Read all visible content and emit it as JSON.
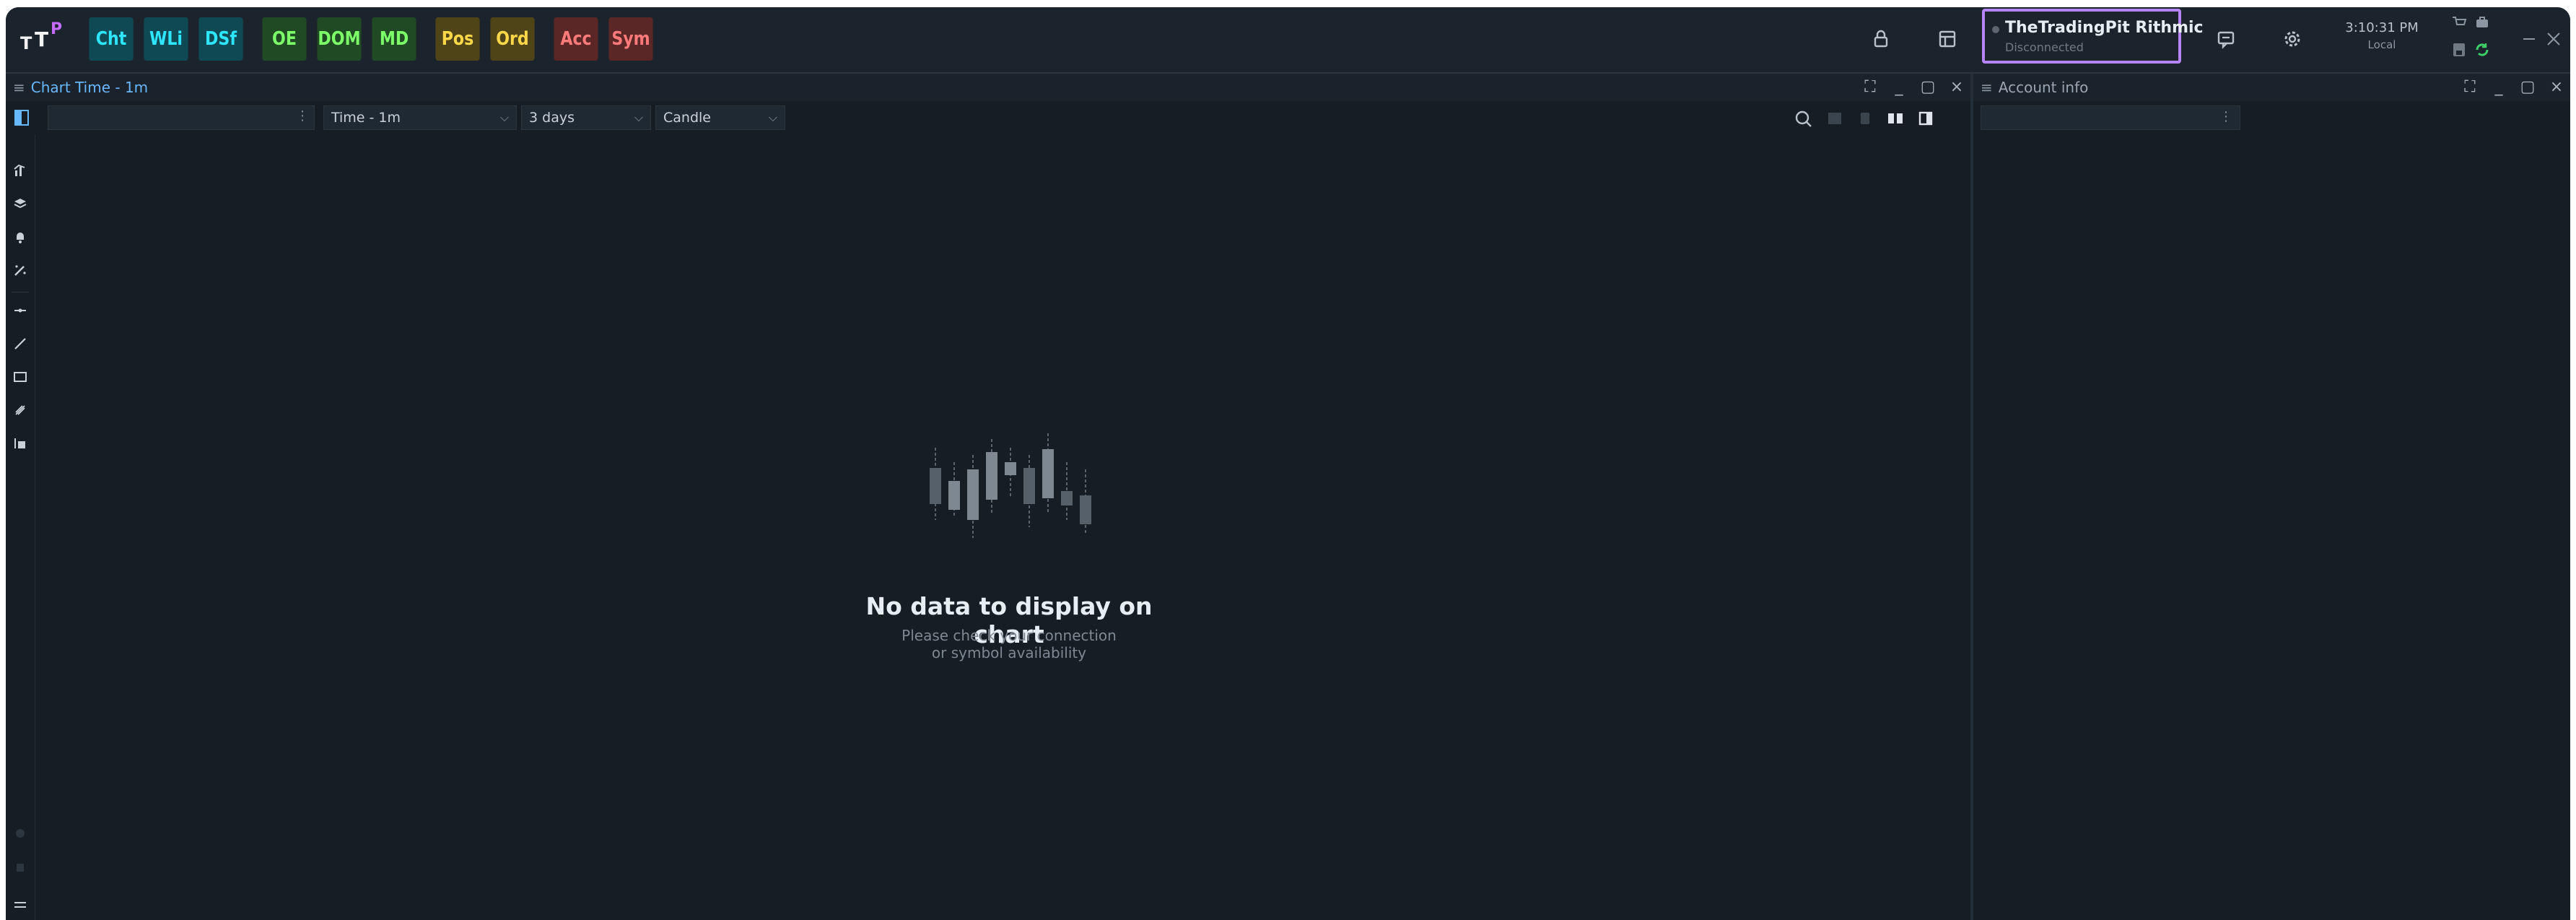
{
  "app": {
    "logo_text": "TTP",
    "modules": [
      {
        "label": "Cht",
        "bg": "#0f4a54",
        "fg": "#2ee6ff"
      },
      {
        "label": "WLi",
        "bg": "#0f4a54",
        "fg": "#2ee6ff"
      },
      {
        "label": "DSf",
        "bg": "#0f4a54",
        "fg": "#2ee6ff"
      },
      {
        "label": "OE",
        "bg": "#1f4a23",
        "fg": "#7dff6a"
      },
      {
        "label": "DOM",
        "bg": "#1f4a23",
        "fg": "#7dff6a"
      },
      {
        "label": "MD",
        "bg": "#1f4a23",
        "fg": "#7dff6a"
      },
      {
        "label": "Pos",
        "bg": "#4f4418",
        "fg": "#ffd84a"
      },
      {
        "label": "Ord",
        "bg": "#4f4418",
        "fg": "#ffd84a"
      },
      {
        "label": "Acc",
        "bg": "#5a2626",
        "fg": "#ff7a7a"
      },
      {
        "label": "Sym",
        "bg": "#5a2626",
        "fg": "#ff7a7a"
      }
    ]
  },
  "connection": {
    "name": "TheTradingPit Rithmic",
    "status": "Disconnected",
    "border_color": "#b584f5"
  },
  "clock": {
    "time": "3:10:31 PM",
    "zone": "Local"
  },
  "chart_panel": {
    "title": "Chart Time - 1m",
    "symbol_placeholder": "",
    "period": "Time - 1m",
    "range": "3 days",
    "style": "Candle",
    "empty_title": "No data to display on chart",
    "empty_line1": "Please check your connection",
    "empty_line2": "or symbol availability"
  },
  "account_panel": {
    "title": "Account info"
  },
  "icons": {
    "lock": "lock-icon",
    "layout": "layout-icon",
    "chat": "chat-icon",
    "settings": "gear-icon"
  }
}
